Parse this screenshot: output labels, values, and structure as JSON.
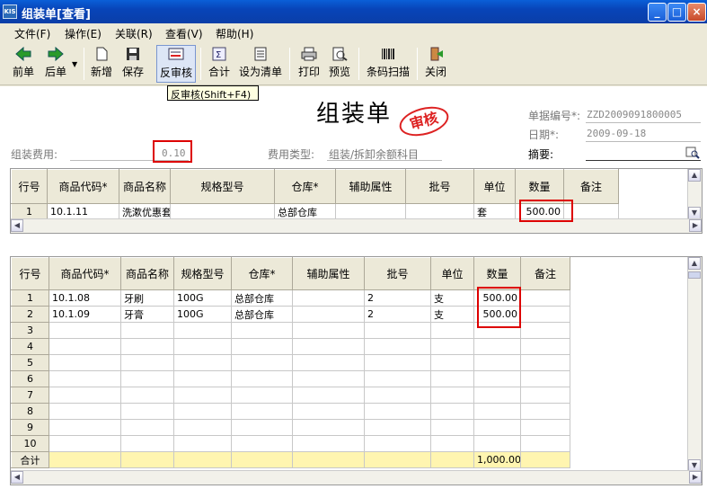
{
  "window": {
    "title": "组装单[查看]",
    "app_icon": "KIS",
    "minimize": "_",
    "maximize": "□",
    "close": "×"
  },
  "menu": [
    {
      "label": "文件(F)"
    },
    {
      "label": "操作(E)"
    },
    {
      "label": "关联(R)"
    },
    {
      "label": "查看(V)"
    },
    {
      "label": "帮助(H)"
    }
  ],
  "toolbar": [
    {
      "label": "前单",
      "icon": "arrow-left-icon"
    },
    {
      "label": "后单",
      "icon": "arrow-right-icon"
    },
    {
      "label": "新增",
      "icon": "new-document-icon"
    },
    {
      "label": "保存",
      "icon": "save-icon"
    },
    {
      "label": "反审核",
      "icon": "unaudit-icon"
    },
    {
      "label": "合计",
      "icon": "sum-icon"
    },
    {
      "label": "设为清单",
      "icon": "list-icon"
    },
    {
      "label": "打印",
      "icon": "print-icon"
    },
    {
      "label": "预览",
      "icon": "preview-icon"
    },
    {
      "label": "条码扫描",
      "icon": "barcode-icon"
    },
    {
      "label": "关闭",
      "icon": "exit-icon"
    }
  ],
  "tooltip": "反审核(Shift+F4)",
  "header": {
    "doc_title": "组装单",
    "stamp": "审核",
    "doc_no_label": "单据编号*:",
    "doc_no": "ZZD2009091800005",
    "date_label": "日期*:",
    "date": "2009-09-18",
    "summary_label": "摘要:",
    "fee_label": "组装费用:",
    "fee": "0.10",
    "fee_type_label": "费用类型:",
    "fee_type": "组装/拆卸余额科目"
  },
  "grid1": {
    "columns": [
      "行号",
      "商品代码*",
      "商品名称",
      "规格型号",
      "仓库*",
      "辅助属性",
      "批号",
      "单位",
      "数量",
      "备注"
    ],
    "rows": [
      [
        "1",
        "10.1.11",
        "洗漱优惠套",
        "",
        "总部仓库",
        "",
        "",
        "套",
        "500.00",
        ""
      ]
    ]
  },
  "grid2": {
    "columns": [
      "行号",
      "商品代码*",
      "商品名称",
      "规格型号",
      "仓库*",
      "辅助属性",
      "批号",
      "单位",
      "数量",
      "备注"
    ],
    "rows": [
      [
        "1",
        "10.1.08",
        "牙刷",
        "100G",
        "总部仓库",
        "",
        "2",
        "支",
        "500.00",
        ""
      ],
      [
        "2",
        "10.1.09",
        "牙膏",
        "100G",
        "总部仓库",
        "",
        "2",
        "支",
        "500.00",
        ""
      ],
      [
        "3",
        "",
        "",
        "",
        "",
        "",
        "",
        "",
        "",
        ""
      ],
      [
        "4",
        "",
        "",
        "",
        "",
        "",
        "",
        "",
        "",
        ""
      ],
      [
        "5",
        "",
        "",
        "",
        "",
        "",
        "",
        "",
        "",
        ""
      ],
      [
        "6",
        "",
        "",
        "",
        "",
        "",
        "",
        "",
        "",
        ""
      ],
      [
        "7",
        "",
        "",
        "",
        "",
        "",
        "",
        "",
        "",
        ""
      ],
      [
        "8",
        "",
        "",
        "",
        "",
        "",
        "",
        "",
        "",
        ""
      ],
      [
        "9",
        "",
        "",
        "",
        "",
        "",
        "",
        "",
        "",
        ""
      ],
      [
        "10",
        "",
        "",
        "",
        "",
        "",
        "",
        "",
        "",
        ""
      ]
    ],
    "footer": [
      "合计",
      "",
      "",
      "",
      "",
      "",
      "",
      "",
      "1,000.00",
      ""
    ]
  },
  "colors": {
    "title_bar": "#0a4fc8",
    "highlight": "#dd0000",
    "stamp": "#dd2222",
    "total_row": "#fff5b0"
  }
}
